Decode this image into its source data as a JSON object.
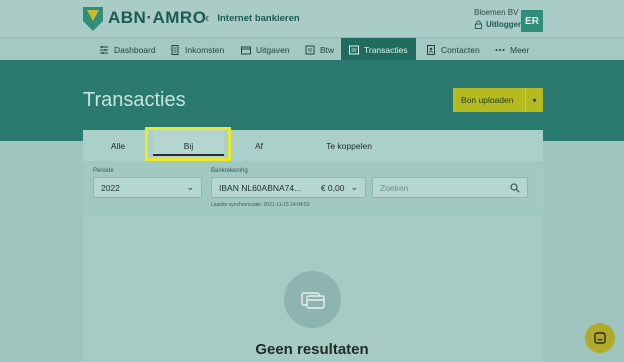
{
  "header": {
    "brand": "ABN·AMRO",
    "back_link": "Internet bankieren",
    "company": "Bloemen BV",
    "logout": "Uitloggen",
    "avatar_initials": "ER"
  },
  "nav": {
    "items": [
      {
        "label": "Dashboard",
        "icon": "dashboard-icon"
      },
      {
        "label": "Inkomsten",
        "icon": "document-icon"
      },
      {
        "label": "Uitgaven",
        "icon": "wallet-icon"
      },
      {
        "label": "Btw",
        "icon": "receipt-icon"
      },
      {
        "label": "Transacties",
        "icon": "list-icon",
        "active": true
      },
      {
        "label": "Contacten",
        "icon": "contact-book-icon"
      },
      {
        "label": "Meer",
        "icon": "more-dots-icon"
      }
    ]
  },
  "page": {
    "title": "Transacties",
    "upload_button": "Bon uploaden"
  },
  "tabs": [
    {
      "label": "Alle"
    },
    {
      "label": "Bij",
      "active": true
    },
    {
      "label": "Af"
    },
    {
      "label": "Te koppelen"
    }
  ],
  "filters": {
    "period_label": "Periode",
    "period_value": "2022",
    "account_label": "Bankrekening",
    "account_value": "IBAN NL60ABNA74...",
    "account_balance": "€ 0,00",
    "search_placeholder": "Zoeken",
    "last_sync": "Laatste synchronisatie: 2021-11-15 14:04:53"
  },
  "empty_state": {
    "title": "Geen resultaten"
  },
  "colors": {
    "primary": "#2a7a70",
    "accent": "#b5bb1e",
    "highlight": "#ece82a"
  }
}
